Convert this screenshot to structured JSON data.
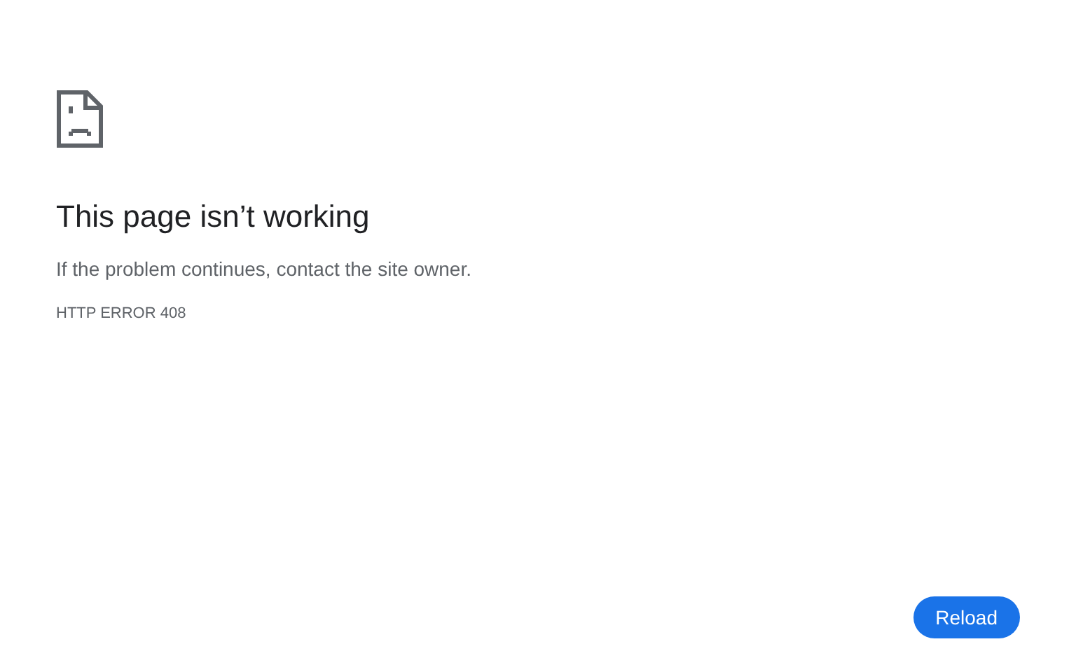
{
  "heading": "This page isn’t working",
  "message": "If the problem continues, contact the site owner.",
  "error_code": "HTTP ERROR 408",
  "buttons": [
    {
      "label": "Reload"
    }
  ]
}
